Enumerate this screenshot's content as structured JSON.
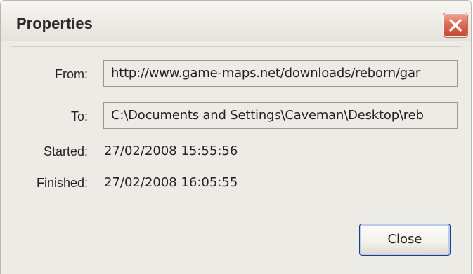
{
  "window": {
    "title": "Properties",
    "close_icon": "close-x-icon"
  },
  "properties": {
    "from_label": "From:",
    "from_value": "http://www.game-maps.net/downloads/reborn/gar",
    "to_label": "To:",
    "to_value": "C:\\Documents and Settings\\Caveman\\Desktop\\reb",
    "started_label": "Started:",
    "started_value": "27/02/2008 15:55:56",
    "finished_label": "Finished:",
    "finished_value": "27/02/2008 16:05:55"
  },
  "buttons": {
    "close_label": "Close"
  },
  "colors": {
    "window_bg": "#ecebe6",
    "close_x_bg": "#e26a4f",
    "button_border": "#1e3d8f"
  }
}
